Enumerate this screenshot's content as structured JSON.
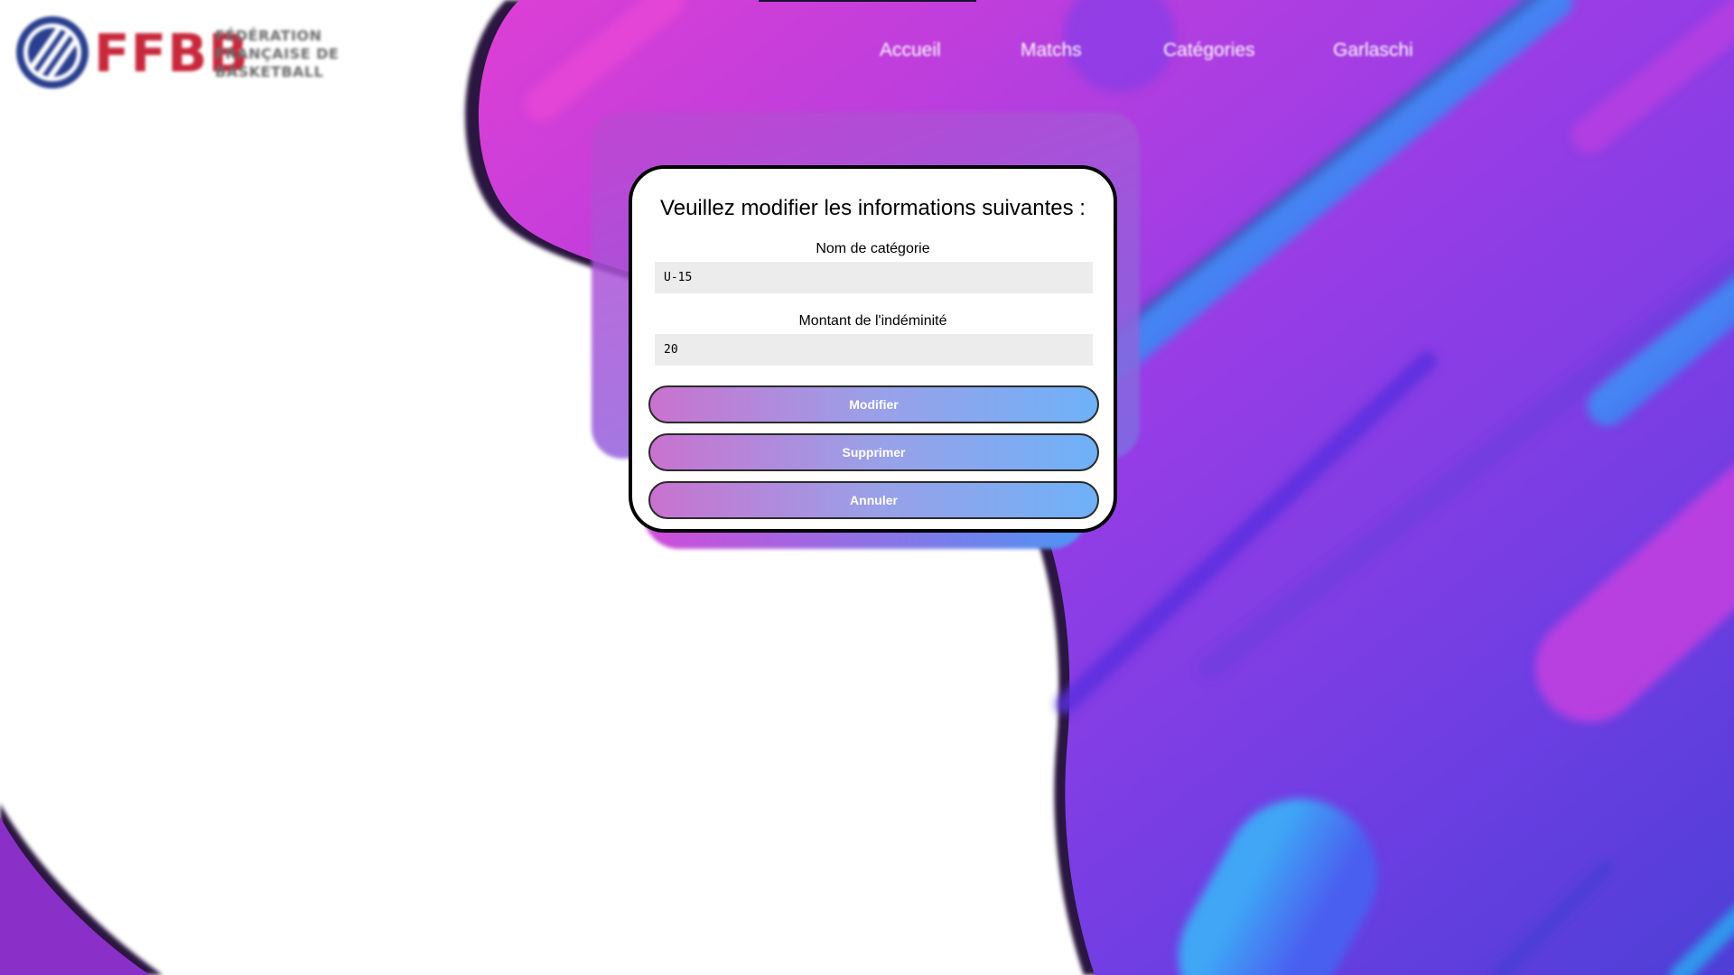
{
  "logo": {
    "letters": "FFBB",
    "line1": "FÉDÉRATION",
    "line2": "FRANÇAISE DE",
    "line3": "BASKETBALL",
    "icon": "basketball-ball-icon",
    "colors": {
      "red": "#c8283c",
      "navy": "#2a3f8f",
      "grey": "#6b6b6b"
    }
  },
  "nav": {
    "items": [
      {
        "label": "Accueil"
      },
      {
        "label": "Matchs"
      },
      {
        "label": "Catégories"
      },
      {
        "label": "Garlaschi"
      }
    ]
  },
  "form": {
    "title": "Veuillez modifier les informations suivantes :",
    "category_label": "Nom de catégorie",
    "category_value": "U-15",
    "amount_label": "Montant de l'indéminité",
    "amount_value": "20",
    "buttons": {
      "modify": "Modifier",
      "delete": "Supprimer",
      "cancel": "Annuler"
    }
  },
  "colors": {
    "gradient_pink": "#d63fd8",
    "gradient_purple": "#7a3fe0",
    "gradient_blue": "#3c8bf5",
    "button_start": "#c972cf",
    "button_end": "#6fb1f7"
  }
}
